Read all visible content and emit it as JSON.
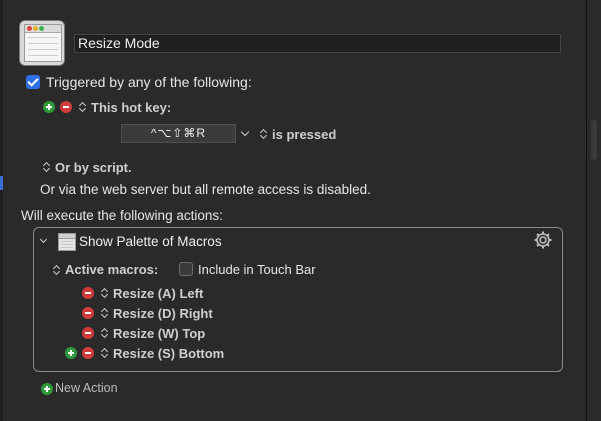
{
  "macro": {
    "name": "Resize Mode"
  },
  "triggers": {
    "enabled_label": "Triggered by any of the following:",
    "hotkey_label": "This hot key:",
    "hotkey_value": "^⌥⇧⌘R",
    "hotkey_condition": "is pressed",
    "script_label": "Or by script.",
    "webserver_note": "Or via the web server but all remote access is disabled."
  },
  "actions": {
    "header": "Will execute the following actions:",
    "items": [
      {
        "title": "Show Palette of Macros",
        "active_macros_label": "Active macros:",
        "touchbar_label": "Include in Touch Bar",
        "touchbar_checked": false,
        "macros": [
          "Resize (A) Left",
          "Resize (D) Right",
          "Resize (W) Top",
          "Resize (S) Bottom"
        ]
      }
    ],
    "new_action_label": "New Action"
  },
  "colors": {
    "background": "#2a2a2a",
    "checkbox_accent": "#2f6fe4",
    "add_green": "#2f9a3a",
    "remove_red": "#d23b3b"
  },
  "icons": [
    "macro-icon",
    "plus-icon",
    "minus-icon",
    "updown-icon",
    "chevron-down-icon",
    "gear-icon",
    "palette-icon"
  ]
}
